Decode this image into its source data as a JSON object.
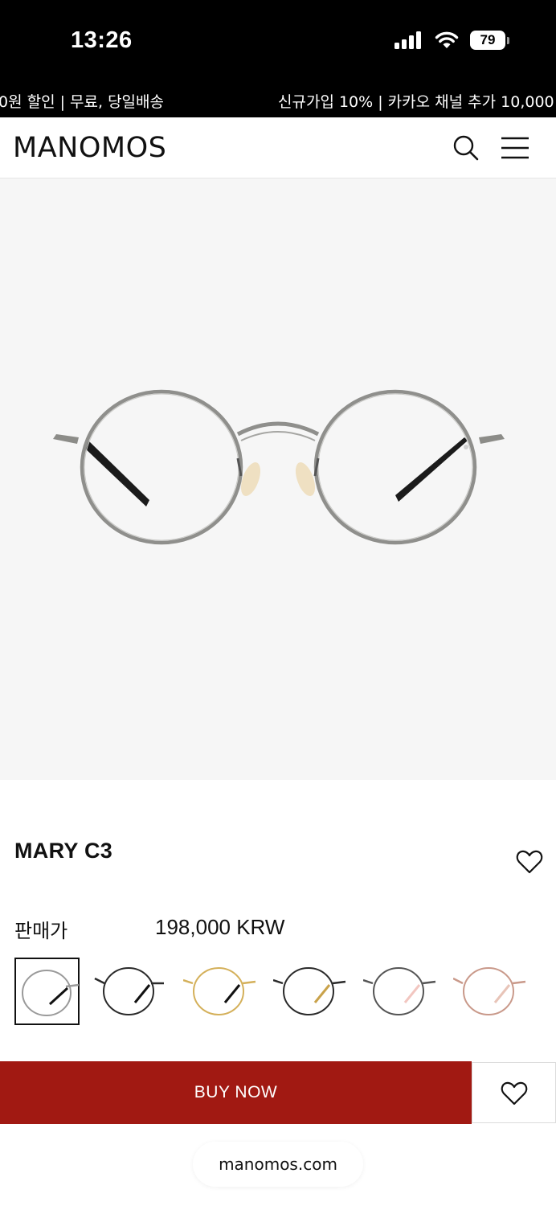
{
  "status_bar": {
    "time": "13:26",
    "battery": "79",
    "icons": [
      "signal-icon",
      "wifi-icon",
      "battery-icon"
    ]
  },
  "promo": {
    "text_1": "0원 할인 | 무료, 당일배송",
    "text_2": "신규가입 10% | 카카오 채널 추가 10,000"
  },
  "header": {
    "logo": "MANOMOS",
    "icons": [
      "search-icon",
      "menu-icon"
    ]
  },
  "product": {
    "name": "MARY C3",
    "price_label": "판매가",
    "price": "198,000 KRW",
    "selected_swatch": 1,
    "swatches": [
      {
        "color": "#9a9a9a",
        "accent": "#111111"
      },
      {
        "color": "#2a2a2a",
        "accent": "#111111"
      },
      {
        "color": "#d4b05a",
        "accent": "#111111"
      },
      {
        "color": "#2a2a2a",
        "accent": "#c9a24a"
      },
      {
        "color": "#555555",
        "accent": "#f2c6c0"
      },
      {
        "color": "#c9998a",
        "accent": "#e8c4b8"
      }
    ]
  },
  "actions": {
    "buy_now": "BUY NOW"
  },
  "browser": {
    "url": "manomos.com"
  },
  "colors": {
    "buy_button": "#a11912",
    "frame": "#8f8f8c",
    "image_background": "#f6f6f6"
  }
}
